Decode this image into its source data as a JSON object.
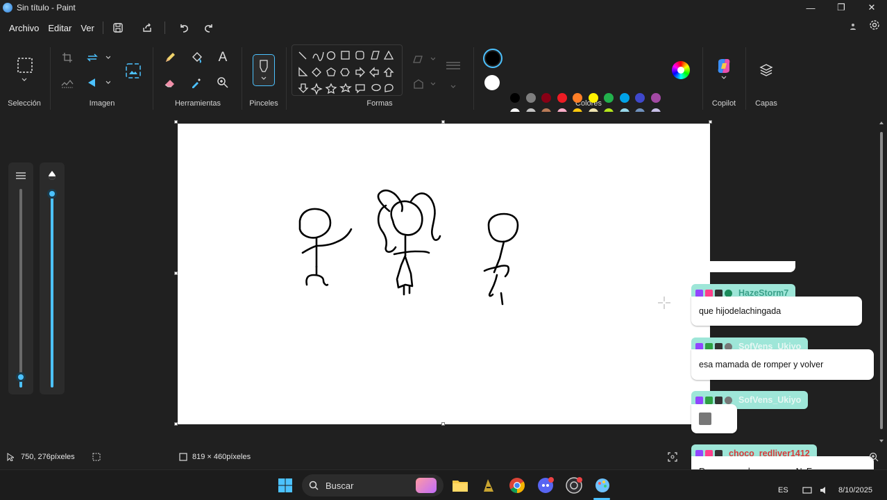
{
  "window": {
    "title": "Sin título - Paint",
    "minimize": "—",
    "restore": "❐",
    "close": "✕"
  },
  "menu": {
    "archivo": "Archivo",
    "editar": "Editar",
    "ver": "Ver"
  },
  "ribbon": {
    "seleccion": "Selección",
    "imagen": "Imagen",
    "herramientas": "Herramientas",
    "pinceles": "Pinceles",
    "formas": "Formas",
    "colores": "Colores",
    "copilot": "Copilot",
    "capas": "Capas",
    "text_tool": "A"
  },
  "colors": {
    "primary": "#000000",
    "secondary": "#ffffff",
    "palette_row1": [
      "#000000",
      "#7f7f7f",
      "#880015",
      "#ed1c24",
      "#ff7f27",
      "#fff200",
      "#22b14c",
      "#00a2e8",
      "#3f48cc",
      "#a349a4"
    ],
    "palette_row2": [
      "#ffffff",
      "#c3c3c3",
      "#b97a57",
      "#ffaec9",
      "#ffc90e",
      "#efe4b0",
      "#b5e61d",
      "#99d9ea",
      "#7092be",
      "#c8bfe7"
    ]
  },
  "status": {
    "cursor": "750, 276píxeles",
    "size": "819 × 460píxeles"
  },
  "chat": {
    "messages": [
      {
        "user": "HazeStorm7",
        "text": "que hijodelachingada",
        "name_color": "#3aa089"
      },
      {
        "user": "SofVens_Ukiyo",
        "text": "esa mamada de romper y volver",
        "name_color": "#e6f7f3"
      },
      {
        "user": "SofVens_Ukiyo",
        "text": "",
        "name_color": "#e6f7f3"
      },
      {
        "user": "choco_redliver1412",
        "text": "Romper y volver es para NyE",
        "name_color": "#d83a3a"
      }
    ]
  },
  "taskbar": {
    "search": "Buscar",
    "lang": "ES",
    "date": "8/10/2025"
  }
}
